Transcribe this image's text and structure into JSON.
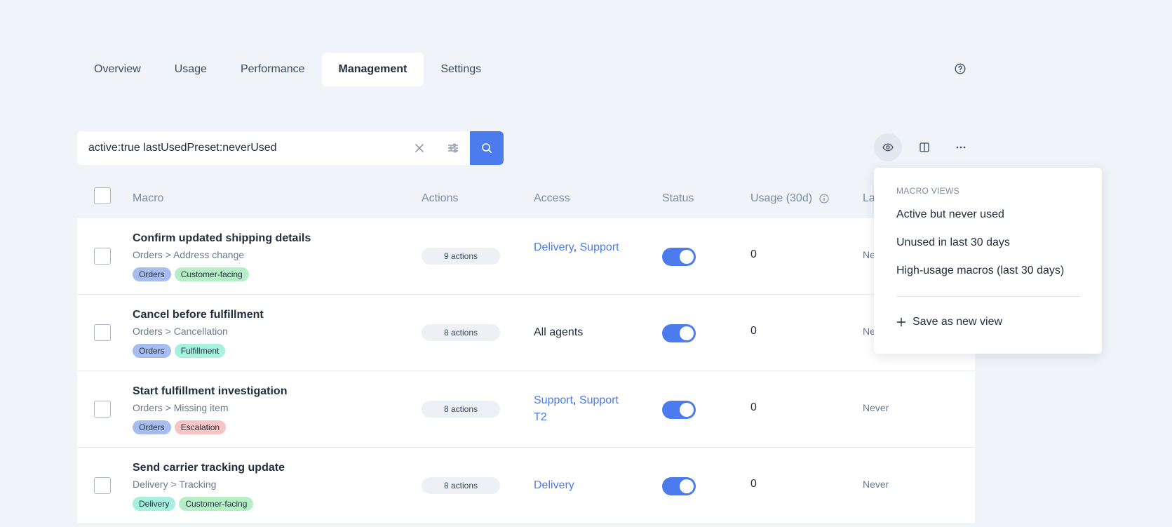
{
  "tabs": [
    {
      "label": "Overview",
      "active": false
    },
    {
      "label": "Usage",
      "active": false
    },
    {
      "label": "Performance",
      "active": false
    },
    {
      "label": "Management",
      "active": true
    },
    {
      "label": "Settings",
      "active": false
    }
  ],
  "search": {
    "value": "active:true lastUsedPreset:neverUsed"
  },
  "table": {
    "headers": {
      "macro": "Macro",
      "actions": "Actions",
      "access": "Access",
      "status": "Status",
      "usage": "Usage (30d)",
      "last_used": "La"
    },
    "rows": [
      {
        "title": "Confirm updated shipping details",
        "path": "Orders > Address change",
        "tags": [
          {
            "label": "Orders",
            "color": "#a7bdf0"
          },
          {
            "label": "Customer-facing",
            "color": "#b6efc6"
          }
        ],
        "actions": "9 actions",
        "access": [
          {
            "text": "Delivery",
            "link": true
          },
          {
            "text": ", ",
            "link": false
          },
          {
            "text": "Support",
            "link": true
          }
        ],
        "status_on": true,
        "usage": "0",
        "last_used": "Ne"
      },
      {
        "title": "Cancel before fulfillment",
        "path": "Orders > Cancellation",
        "tags": [
          {
            "label": "Orders",
            "color": "#a7bdf0"
          },
          {
            "label": "Fulfillment",
            "color": "#a6f0de"
          }
        ],
        "actions": "8 actions",
        "access": [
          {
            "text": "All agents",
            "link": false
          }
        ],
        "status_on": true,
        "usage": "0",
        "last_used": "Ne"
      },
      {
        "title": "Start fulfillment investigation",
        "path": "Orders > Missing item",
        "tags": [
          {
            "label": "Orders",
            "color": "#a7bdf0"
          },
          {
            "label": "Escalation",
            "color": "#f8c4c4"
          }
        ],
        "actions": "8 actions",
        "access": [
          {
            "text": "Support",
            "link": true
          },
          {
            "text": ", ",
            "link": false
          },
          {
            "text": "Support T2",
            "link": true
          }
        ],
        "status_on": true,
        "usage": "0",
        "last_used": "Never"
      },
      {
        "title": "Send carrier tracking update",
        "path": "Delivery > Tracking",
        "tags": [
          {
            "label": "Delivery",
            "color": "#a6f0de"
          },
          {
            "label": "Customer-facing",
            "color": "#b6efc6"
          }
        ],
        "actions": "8 actions",
        "access": [
          {
            "text": "Delivery",
            "link": true
          }
        ],
        "status_on": true,
        "usage": "0",
        "last_used": "Never"
      }
    ]
  },
  "dropdown": {
    "heading": "MACRO VIEWS",
    "items": [
      "Active but never used",
      "Unused in last 30 days",
      "High-usage macros (last 30 days)"
    ],
    "save_label": "Save as new view"
  },
  "colors": {
    "accent": "#4b7bec",
    "background": "#f0f3f8"
  },
  "icons": {
    "help": "help-circle-icon",
    "clear": "close-icon",
    "filters": "sliders-icon",
    "search": "search-icon",
    "view": "eye-icon",
    "columns": "columns-icon",
    "more": "more-horizontal-icon",
    "usage_info": "info-icon",
    "save": "plus-icon"
  }
}
